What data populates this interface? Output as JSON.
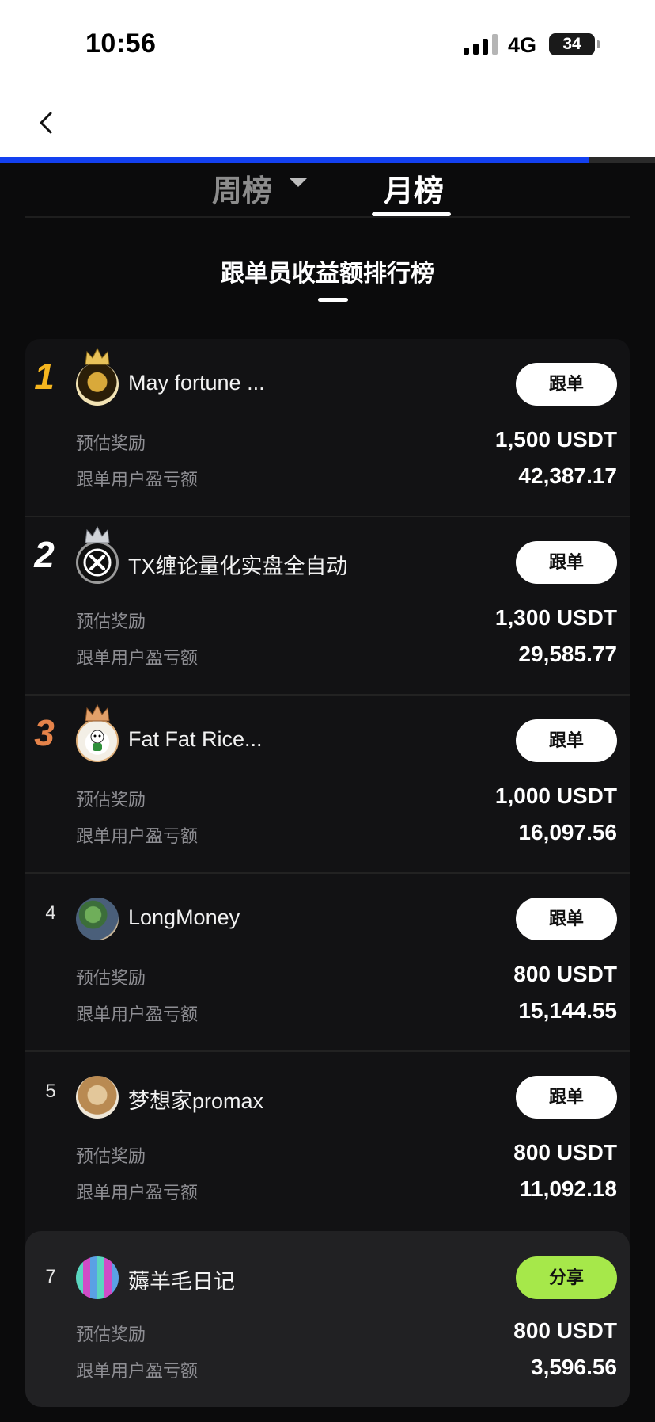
{
  "status_bar": {
    "time": "10:56",
    "network": "4G",
    "battery": "34"
  },
  "tabs": {
    "week": "周榜",
    "month": "月榜"
  },
  "board_title": "跟单员收益额排行榜",
  "labels": {
    "reward": "预估奖励",
    "pnl": "跟单用户盈亏额"
  },
  "progress": {
    "fraction": 0.9
  },
  "entries": [
    {
      "rank": "1",
      "name": "May fortune ...",
      "button": "跟单",
      "reward": "1,500 USDT",
      "pnl": "42,387.17"
    },
    {
      "rank": "2",
      "name": "TX缠论量化实盘全自动",
      "button": "跟单",
      "reward": "1,300 USDT",
      "pnl": "29,585.77"
    },
    {
      "rank": "3",
      "name": "Fat Fat Rice...",
      "button": "跟单",
      "reward": "1,000 USDT",
      "pnl": "16,097.56"
    },
    {
      "rank": "4",
      "name": "LongMoney",
      "button": "跟单",
      "reward": "800 USDT",
      "pnl": "15,144.55"
    },
    {
      "rank": "5",
      "name": "梦想家promax",
      "button": "跟单",
      "reward": "800 USDT",
      "pnl": "11,092.18"
    }
  ],
  "self": {
    "rank": "7",
    "name": "薅羊毛日记",
    "button": "分享",
    "reward": "800 USDT",
    "pnl": "3,596.56"
  },
  "colors": {
    "gold": "#f5b51f",
    "silver": "#ffffff",
    "bronze": "#e5834a",
    "share_green": "#a6e84a",
    "progress_blue": "#1340f0"
  }
}
